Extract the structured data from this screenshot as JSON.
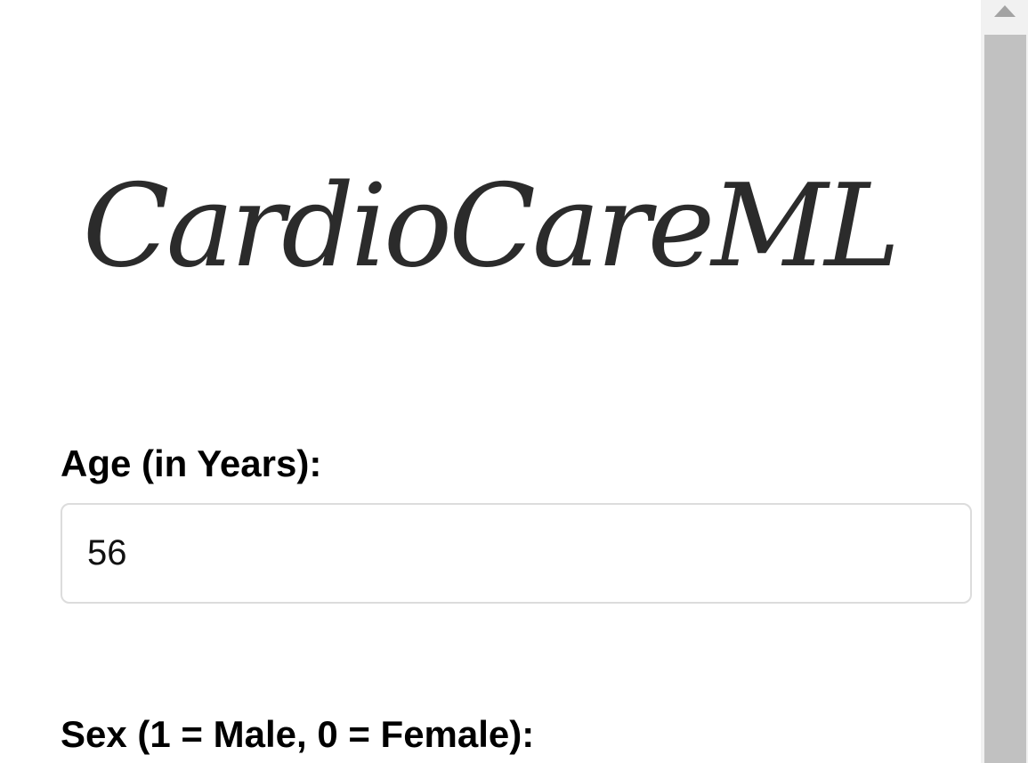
{
  "brand": {
    "logo_text": "CardioCareML"
  },
  "form": {
    "age": {
      "label": "Age (in Years):",
      "value": "56"
    },
    "sex": {
      "label": "Sex (1 = Male, 0 = Female):"
    }
  },
  "scrollbar": {
    "up_icon": "triangle-up-icon"
  },
  "colors": {
    "logo": "#2b2b2b",
    "input_border": "#dcdcdc",
    "scrollbar_track": "#f1f1f1",
    "scrollbar_thumb": "#c1c1c1"
  }
}
